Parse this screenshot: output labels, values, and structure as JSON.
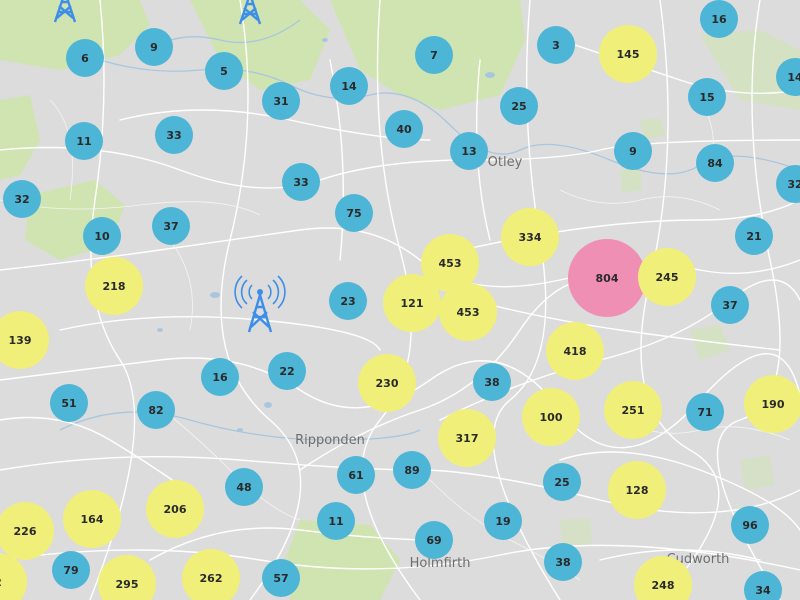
{
  "map": {
    "colors": {
      "land": "#dcdcdc",
      "green": "#cfe4b0",
      "road": "#ffffff",
      "water": "#a9c6de",
      "label": "#6e6e6e",
      "small_cluster": "#4db5d6",
      "medium_cluster": "#f0ef7a",
      "large_cluster": "#f08fb4",
      "tower_icon": "#3d8ee8"
    },
    "place_labels": [
      {
        "name": "Otley"
      },
      {
        "name": "Ripponden"
      },
      {
        "name": "Holmfirth"
      },
      {
        "name": "Cudworth"
      }
    ],
    "clusters": [
      {
        "count": "6",
        "size": "small"
      },
      {
        "count": "9",
        "size": "small"
      },
      {
        "count": "5",
        "size": "small"
      },
      {
        "count": "7",
        "size": "small"
      },
      {
        "count": "3",
        "size": "small"
      },
      {
        "count": "145",
        "size": "medium"
      },
      {
        "count": "16",
        "size": "small"
      },
      {
        "count": "14",
        "size": "small"
      },
      {
        "count": "31",
        "size": "small"
      },
      {
        "count": "25",
        "size": "small"
      },
      {
        "count": "15",
        "size": "small"
      },
      {
        "count": "14",
        "size": "small"
      },
      {
        "count": "11",
        "size": "small"
      },
      {
        "count": "33",
        "size": "small"
      },
      {
        "count": "40",
        "size": "small"
      },
      {
        "count": "13",
        "size": "small"
      },
      {
        "count": "9",
        "size": "small"
      },
      {
        "count": "84",
        "size": "small"
      },
      {
        "count": "32",
        "size": "small"
      },
      {
        "count": "33",
        "size": "small"
      },
      {
        "count": "32",
        "size": "small"
      },
      {
        "count": "75",
        "size": "small"
      },
      {
        "count": "10",
        "size": "small"
      },
      {
        "count": "37",
        "size": "small"
      },
      {
        "count": "334",
        "size": "medium"
      },
      {
        "count": "21",
        "size": "small"
      },
      {
        "count": "453",
        "size": "medium"
      },
      {
        "count": "804",
        "size": "large"
      },
      {
        "count": "245",
        "size": "medium"
      },
      {
        "count": "218",
        "size": "medium"
      },
      {
        "count": "23",
        "size": "small"
      },
      {
        "count": "121",
        "size": "medium"
      },
      {
        "count": "453",
        "size": "medium"
      },
      {
        "count": "37",
        "size": "small"
      },
      {
        "count": "139",
        "size": "medium"
      },
      {
        "count": "418",
        "size": "medium"
      },
      {
        "count": "16",
        "size": "small"
      },
      {
        "count": "22",
        "size": "small"
      },
      {
        "count": "230",
        "size": "medium"
      },
      {
        "count": "38",
        "size": "small"
      },
      {
        "count": "51",
        "size": "small"
      },
      {
        "count": "82",
        "size": "small"
      },
      {
        "count": "100",
        "size": "medium"
      },
      {
        "count": "251",
        "size": "medium"
      },
      {
        "count": "71",
        "size": "small"
      },
      {
        "count": "190",
        "size": "medium"
      },
      {
        "count": "317",
        "size": "medium"
      },
      {
        "count": "61",
        "size": "small"
      },
      {
        "count": "89",
        "size": "small"
      },
      {
        "count": "48",
        "size": "small"
      },
      {
        "count": "25",
        "size": "small"
      },
      {
        "count": "128",
        "size": "medium"
      },
      {
        "count": "206",
        "size": "medium"
      },
      {
        "count": "164",
        "size": "medium"
      },
      {
        "count": "226",
        "size": "medium"
      },
      {
        "count": "11",
        "size": "small"
      },
      {
        "count": "19",
        "size": "small"
      },
      {
        "count": "96",
        "size": "small"
      },
      {
        "count": "69",
        "size": "small"
      },
      {
        "count": "79",
        "size": "small"
      },
      {
        "count": "295",
        "size": "medium"
      },
      {
        "count": "262",
        "size": "medium"
      },
      {
        "count": "57",
        "size": "small"
      },
      {
        "count": "38",
        "size": "small"
      },
      {
        "count": "248",
        "size": "medium"
      },
      {
        "count": "34",
        "size": "small"
      },
      {
        "count": "2",
        "size": "medium"
      }
    ],
    "tower_icons": [
      {
        "type": "tower-icon"
      },
      {
        "type": "tower-icon"
      },
      {
        "type": "broadcast-tower-icon"
      }
    ]
  }
}
